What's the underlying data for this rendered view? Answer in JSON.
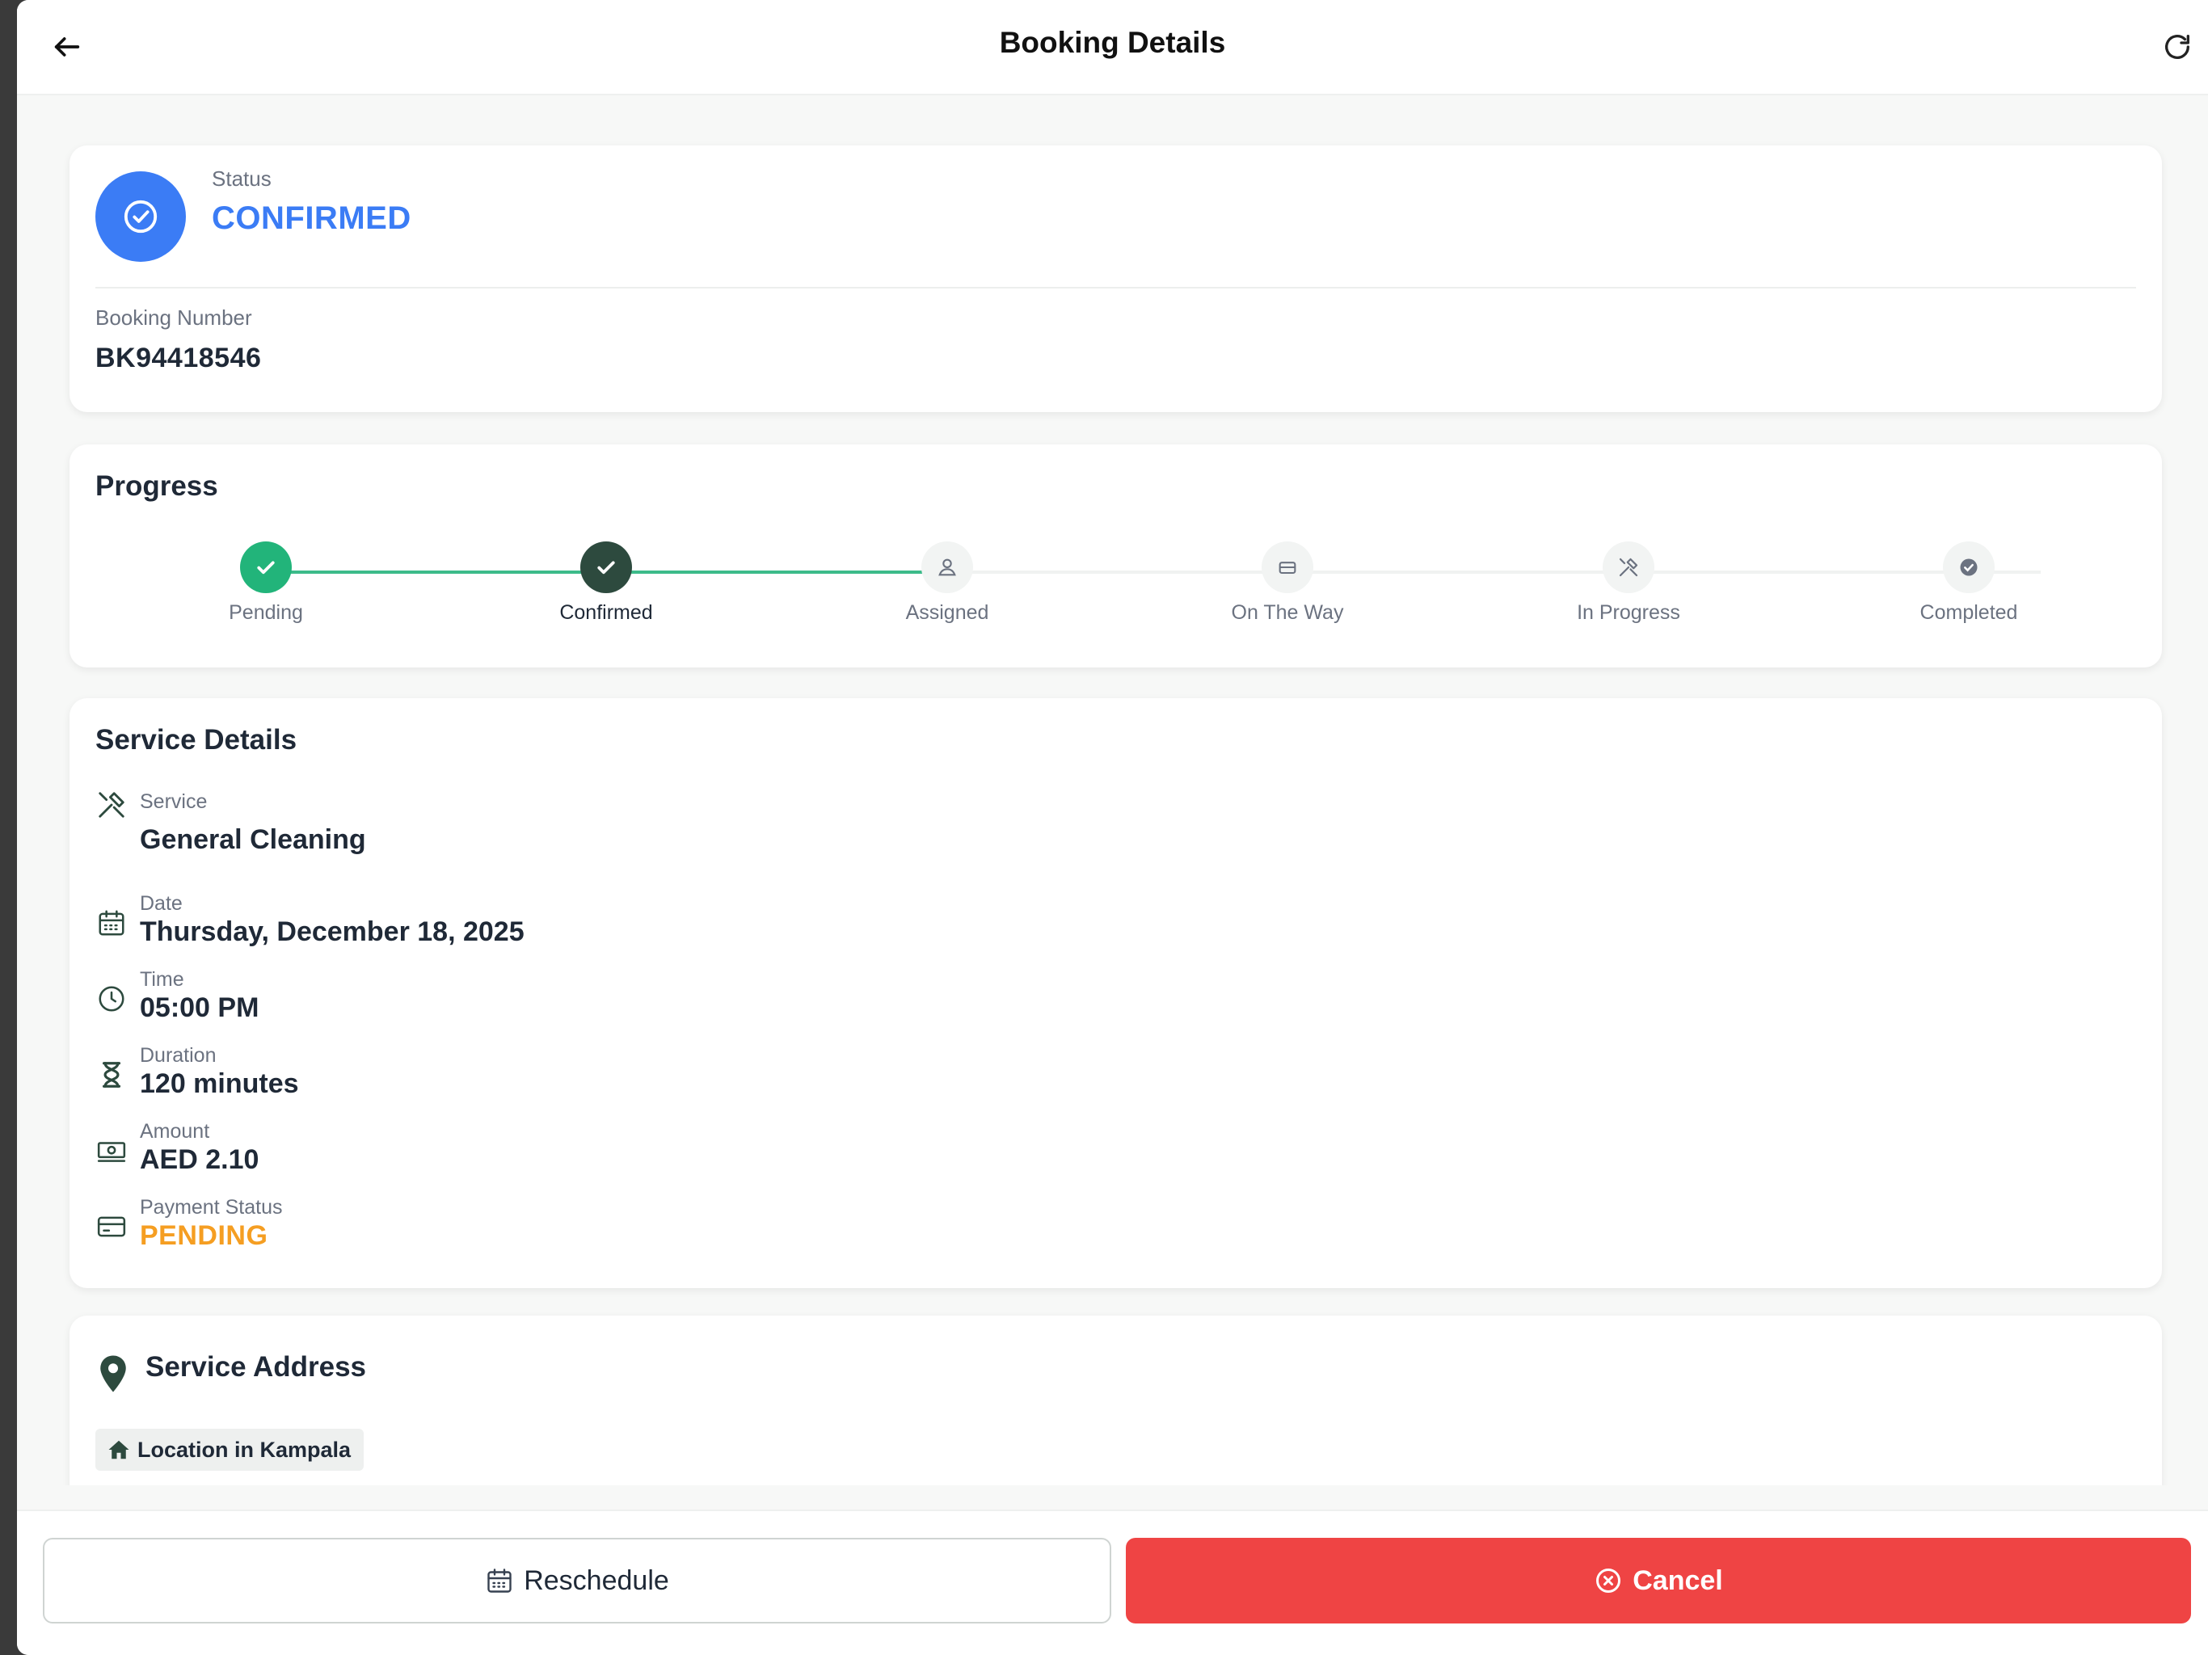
{
  "header": {
    "title": "Booking Details"
  },
  "status": {
    "label": "Status",
    "value": "CONFIRMED",
    "booking_number_label": "Booking Number",
    "booking_number": "BK94418546"
  },
  "progress": {
    "title": "Progress",
    "steps": [
      {
        "label": "Pending",
        "state": "done"
      },
      {
        "label": "Confirmed",
        "state": "current"
      },
      {
        "label": "Assigned",
        "state": "upcoming"
      },
      {
        "label": "On The Way",
        "state": "upcoming"
      },
      {
        "label": "In Progress",
        "state": "upcoming"
      },
      {
        "label": "Completed",
        "state": "upcoming"
      }
    ]
  },
  "details": {
    "title": "Service Details",
    "service": {
      "label": "Service",
      "value": "General Cleaning"
    },
    "date": {
      "label": "Date",
      "value": "Thursday, December 18, 2025"
    },
    "time": {
      "label": "Time",
      "value": "05:00 PM"
    },
    "duration": {
      "label": "Duration",
      "value": "120 minutes"
    },
    "amount": {
      "label": "Amount",
      "value": "AED 2.10"
    },
    "payment": {
      "label": "Payment Status",
      "value": "PENDING"
    }
  },
  "address": {
    "title": "Service Address",
    "location": "Location in Kampala"
  },
  "actions": {
    "reschedule": "Reschedule",
    "cancel": "Cancel"
  },
  "colors": {
    "primary_blue": "#3b7cf5",
    "green": "#22b47a",
    "dark_green": "#2d4a3e",
    "pending_orange": "#f59e22",
    "cancel_red": "#ef4444"
  }
}
